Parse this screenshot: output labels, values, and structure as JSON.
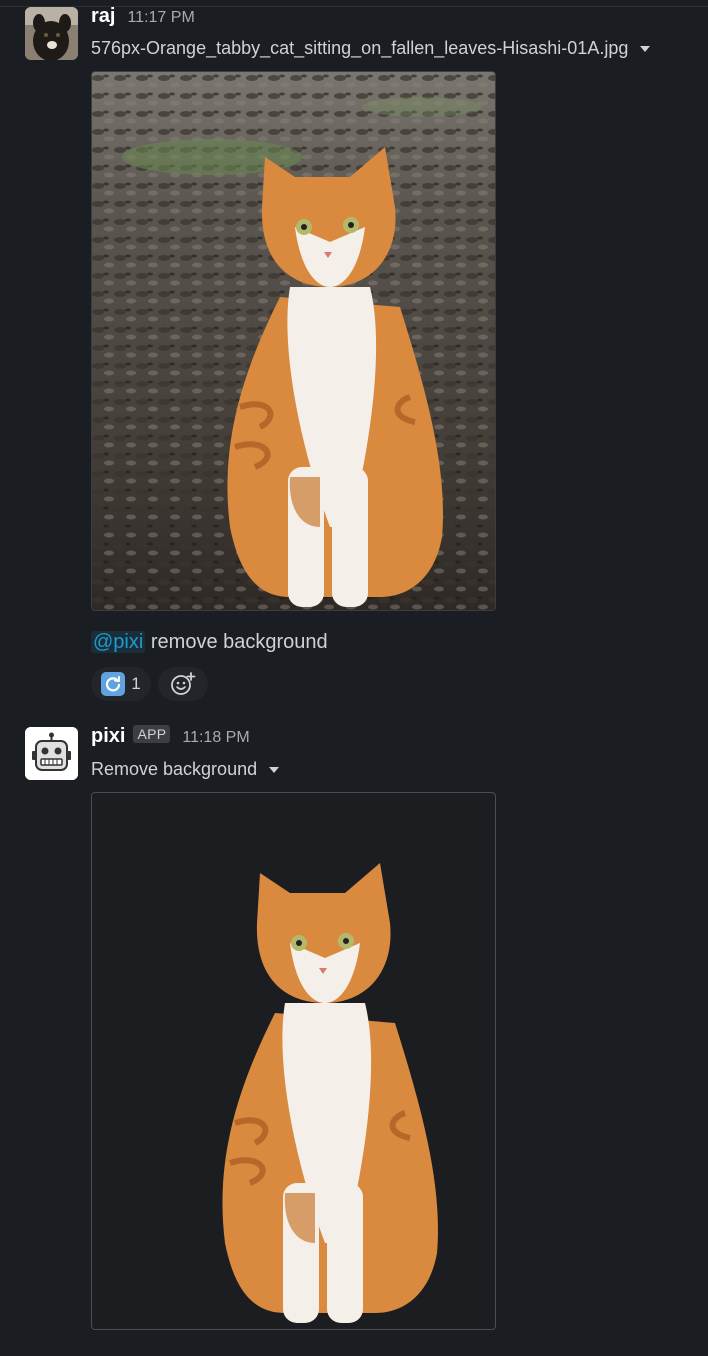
{
  "messages": [
    {
      "author": "raj",
      "time": "11:17 PM",
      "file_name": "576px-Orange_tabby_cat_sitting_on_fallen_leaves-Hisashi-01A.jpg",
      "mention": "@pixi",
      "text": "remove background",
      "reactions": [
        {
          "emoji": "arrows-counterclockwise-icon",
          "count": "1"
        }
      ]
    },
    {
      "author": "pixi",
      "badge": "APP",
      "time": "11:18 PM",
      "file_name": "Remove background"
    }
  ],
  "colors": {
    "background": "#1a1d21",
    "mention": "#1d9bd1",
    "author": "#ffffff",
    "muted": "#ababad",
    "cat_orange": "#d98a3e",
    "cat_white": "#f4efe8"
  }
}
